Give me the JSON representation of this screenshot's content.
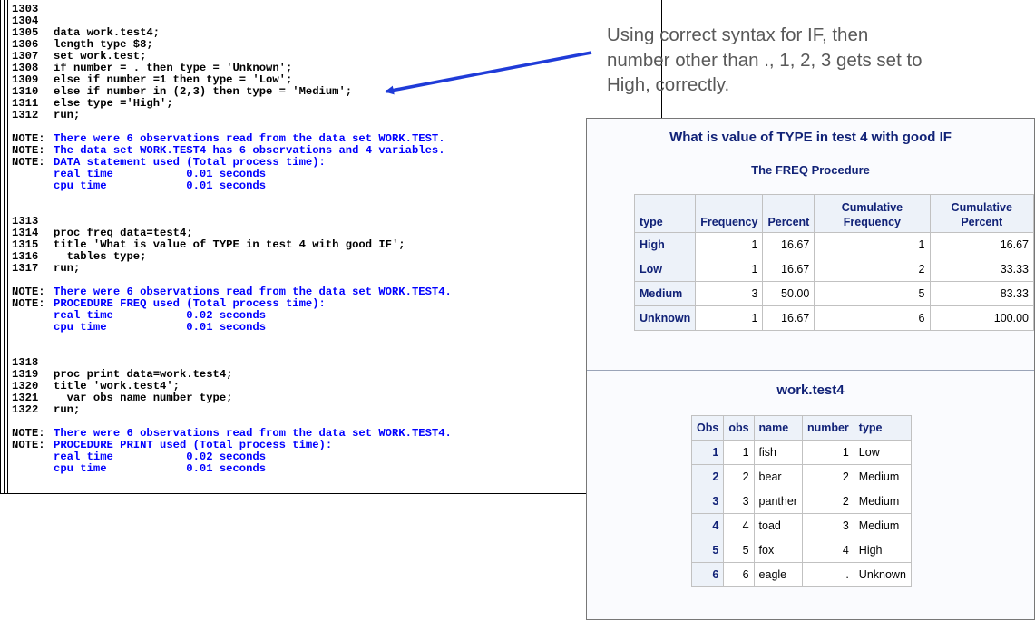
{
  "log": {
    "lines": [
      {
        "num": "1303",
        "text": "",
        "kind": "code"
      },
      {
        "num": "1304",
        "text": "",
        "kind": "code"
      },
      {
        "num": "1305",
        "text": "data work.test4;",
        "kind": "code"
      },
      {
        "num": "1306",
        "text": "length type $8;",
        "kind": "code"
      },
      {
        "num": "1307",
        "text": "set work.test;",
        "kind": "code"
      },
      {
        "num": "1308",
        "text": "if number = . then type = 'Unknown';",
        "kind": "code"
      },
      {
        "num": "1309",
        "text": "else if number =1 then type = 'Low';",
        "kind": "code"
      },
      {
        "num": "1310",
        "text": "else if number in (2,3) then type = 'Medium';",
        "kind": "code"
      },
      {
        "num": "1311",
        "text": "else type ='High';",
        "kind": "code"
      },
      {
        "num": "1312",
        "text": "run;",
        "kind": "code"
      },
      {
        "num": "",
        "text": "",
        "kind": "code"
      },
      {
        "num": "NOTE:",
        "text": "There were 6 observations read from the data set WORK.TEST.",
        "kind": "note"
      },
      {
        "num": "NOTE:",
        "text": "The data set WORK.TEST4 has 6 observations and 4 variables.",
        "kind": "note"
      },
      {
        "num": "NOTE:",
        "text": "DATA statement used (Total process time):",
        "kind": "note"
      },
      {
        "num": "",
        "text": "real time           0.01 seconds",
        "kind": "note"
      },
      {
        "num": "",
        "text": "cpu time            0.01 seconds",
        "kind": "note"
      },
      {
        "num": "",
        "text": "",
        "kind": "code"
      },
      {
        "num": "",
        "text": "",
        "kind": "code"
      },
      {
        "num": "1313",
        "text": "",
        "kind": "code"
      },
      {
        "num": "1314",
        "text": "proc freq data=test4;",
        "kind": "code"
      },
      {
        "num": "1315",
        "text": "title 'What is value of TYPE in test 4 with good IF';",
        "kind": "code"
      },
      {
        "num": "1316",
        "text": "  tables type;",
        "kind": "code"
      },
      {
        "num": "1317",
        "text": "run;",
        "kind": "code"
      },
      {
        "num": "",
        "text": "",
        "kind": "code"
      },
      {
        "num": "NOTE:",
        "text": "There were 6 observations read from the data set WORK.TEST4.",
        "kind": "note"
      },
      {
        "num": "NOTE:",
        "text": "PROCEDURE FREQ used (Total process time):",
        "kind": "note"
      },
      {
        "num": "",
        "text": "real time           0.02 seconds",
        "kind": "note"
      },
      {
        "num": "",
        "text": "cpu time            0.01 seconds",
        "kind": "note"
      },
      {
        "num": "",
        "text": "",
        "kind": "code"
      },
      {
        "num": "",
        "text": "",
        "kind": "code"
      },
      {
        "num": "1318",
        "text": "",
        "kind": "code"
      },
      {
        "num": "1319",
        "text": "proc print data=work.test4;",
        "kind": "code"
      },
      {
        "num": "1320",
        "text": "title 'work.test4';",
        "kind": "code"
      },
      {
        "num": "1321",
        "text": "  var obs name number type;",
        "kind": "code"
      },
      {
        "num": "1322",
        "text": "run;",
        "kind": "code"
      },
      {
        "num": "",
        "text": "",
        "kind": "code"
      },
      {
        "num": "NOTE:",
        "text": "There were 6 observations read from the data set WORK.TEST4.",
        "kind": "note"
      },
      {
        "num": "NOTE:",
        "text": "PROCEDURE PRINT used (Total process time):",
        "kind": "note"
      },
      {
        "num": "",
        "text": "real time           0.02 seconds",
        "kind": "note"
      },
      {
        "num": "",
        "text": "cpu time            0.01 seconds",
        "kind": "note"
      }
    ]
  },
  "annotation": {
    "text": "Using correct syntax for IF, then number other than ., 1, 2, 3 gets set to High, correctly.",
    "arrow_color": "#1f3bd8",
    "text_color": "#595959"
  },
  "results": {
    "freq": {
      "title": "What is value of TYPE in test 4 with good IF",
      "subtitle": "The FREQ Procedure",
      "headers": [
        "type",
        "Frequency",
        "Percent",
        "Cumulative Frequency",
        "Cumulative Percent"
      ],
      "rows": [
        [
          "High",
          "1",
          "16.67",
          "1",
          "16.67"
        ],
        [
          "Low",
          "1",
          "16.67",
          "2",
          "33.33"
        ],
        [
          "Medium",
          "3",
          "50.00",
          "5",
          "83.33"
        ],
        [
          "Unknown",
          "1",
          "16.67",
          "6",
          "100.00"
        ]
      ]
    },
    "print": {
      "title": "work.test4",
      "headers": [
        "Obs",
        "obs",
        "name",
        "number",
        "type"
      ],
      "rows": [
        [
          "1",
          "1",
          "fish",
          "1",
          "Low"
        ],
        [
          "2",
          "2",
          "bear",
          "2",
          "Medium"
        ],
        [
          "3",
          "3",
          "panther",
          "2",
          "Medium"
        ],
        [
          "4",
          "4",
          "toad",
          "3",
          "Medium"
        ],
        [
          "5",
          "5",
          "fox",
          "4",
          "High"
        ],
        [
          "6",
          "6",
          "eagle",
          ".",
          "Unknown"
        ]
      ]
    },
    "header_color": "#112277",
    "header_bg": "#edf2f9"
  }
}
